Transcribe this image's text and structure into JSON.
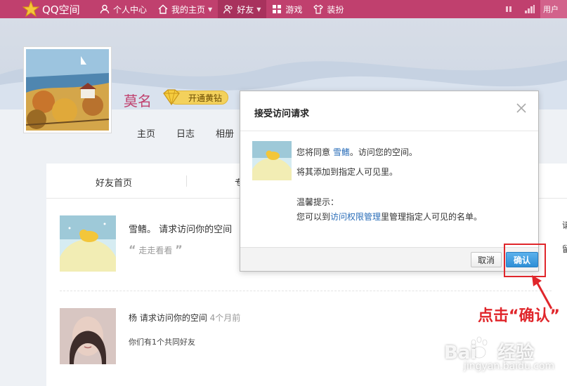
{
  "topnav": {
    "logo_text": "QQ空间",
    "items": [
      {
        "label": "个人中心",
        "icon": "person-icon"
      },
      {
        "label": "我的主页",
        "icon": "home-icon"
      },
      {
        "label": "好友",
        "icon": "friends-icon"
      },
      {
        "label": "游戏",
        "icon": "game-icon"
      },
      {
        "label": "装扮",
        "icon": "tshirt-icon"
      }
    ],
    "active_item": "好友",
    "user_label": "用户"
  },
  "profile": {
    "name": "莫名",
    "vip_label": "开通黄钻",
    "subnav": [
      "主页",
      "日志",
      "相册"
    ]
  },
  "content": {
    "tabs": [
      "好友首页",
      "专"
    ],
    "requests": [
      {
        "name": "雪鳍。 请求访问你的空间",
        "quote": "走走看看"
      },
      {
        "name": "杨 请求访问你的空间",
        "time": "4个月前",
        "sub": "你们有1个共同好友"
      }
    ]
  },
  "dialog": {
    "title": "接受访问请求",
    "line1_prefix": "您将同意",
    "line1_link": "雪鳍",
    "line1_suffix": "。访问您的空间。",
    "line2": "将其添加到指定人可见里。",
    "tip_title": "温馨提示：",
    "tip_prefix": "您可以到",
    "tip_link": "访问权限管理",
    "tip_suffix": "里管理指定人可见的名单。",
    "cancel_label": "取消",
    "confirm_label": "确认"
  },
  "annotation": {
    "callout": "点击“确认”",
    "color": "#e0262b"
  },
  "watermark": {
    "brand": "Bai",
    "brand2": "经验",
    "url": "jingyan.baidu.com"
  },
  "colors": {
    "nav_bg": "#c0406e",
    "accent_blue": "#2f8fd6",
    "link": "#2a6db8"
  }
}
